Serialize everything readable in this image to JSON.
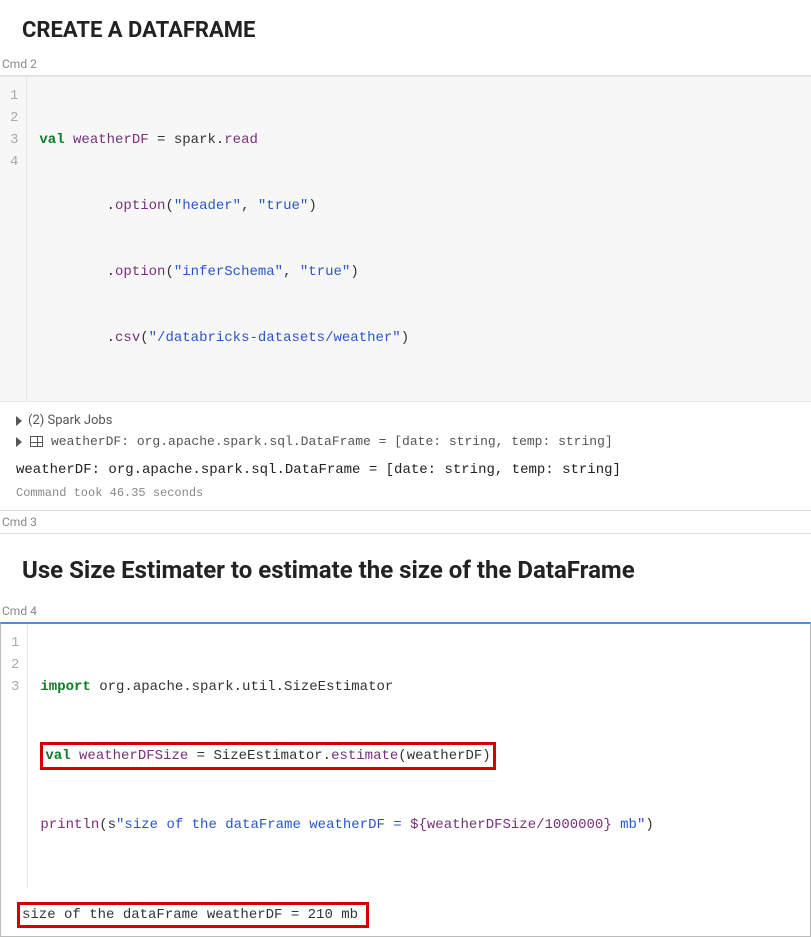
{
  "heading1": "CREATE A DATAFRAME",
  "cmd2_label": "Cmd 2",
  "cmd2_code": {
    "ln1": "1",
    "ln2": "2",
    "ln3": "3",
    "ln4": "4",
    "l1_kw": "val",
    "l1_ident": "weatherDF",
    "l1_rest_a": " = spark.",
    "l1_rest_b": "read",
    "l2_a": "        .",
    "l2_b": "option",
    "l2_c": "(",
    "l2_s1": "\"header\"",
    "l2_d": ", ",
    "l2_s2": "\"true\"",
    "l2_e": ")",
    "l3_a": "        .",
    "l3_b": "option",
    "l3_c": "(",
    "l3_s1": "\"inferSchema\"",
    "l3_d": ", ",
    "l3_s2": "\"true\"",
    "l3_e": ")",
    "l4_a": "        .",
    "l4_b": "csv",
    "l4_c": "(",
    "l4_s1": "\"/databricks-datasets/weather\"",
    "l4_d": ")"
  },
  "spark_jobs": "(2) Spark Jobs",
  "schema_line": "weatherDF:  org.apache.spark.sql.DataFrame = [date: string, temp: string]",
  "result_line": "weatherDF: org.apache.spark.sql.DataFrame = [date: string, temp: string]",
  "timing": "Command took 46.35 seconds",
  "cmd3_label": "Cmd 3",
  "heading2": "Use Size Estimater to estimate the size of the DataFrame",
  "cmd4_label": "Cmd 4",
  "cmd4_code": {
    "ln1": "1",
    "ln2": "2",
    "ln3": "3",
    "l1_kw": "import",
    "l1_rest": " org.apache.spark.util.SizeEstimator",
    "l2_kw": "val",
    "l2_ident": " weatherDFSize",
    "l2_mid": " = SizeEstimator.",
    "l2_call": "estimate",
    "l2_paren": "(weatherDF)",
    "l3_call": "println",
    "l3_a": "(s",
    "l3_s1": "\"size of the dataFrame weatherDF = ",
    "l3_interp": "${weatherDFSize/1000000}",
    "l3_s2": " mb\"",
    "l3_b": ")"
  },
  "output4": "size of the dataFrame weatherDF = 210 mb"
}
